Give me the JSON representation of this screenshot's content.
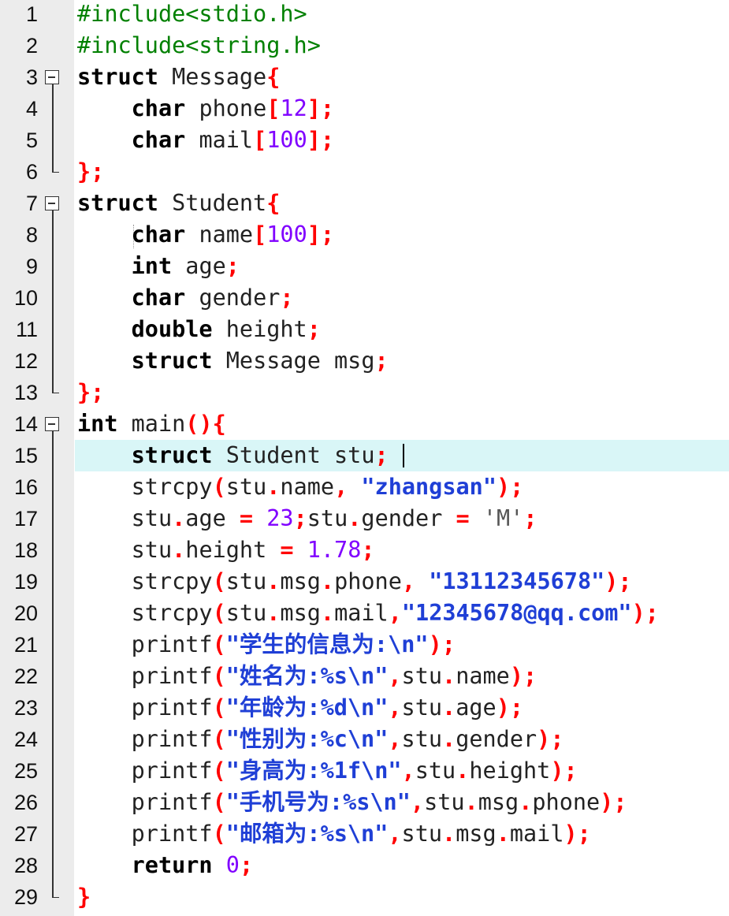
{
  "editor": {
    "language": "C",
    "current_line": 15,
    "lines": [
      {
        "n": "1",
        "tokens": [
          {
            "t": "#include<stdio.h>",
            "c": "pp"
          }
        ]
      },
      {
        "n": "2",
        "tokens": [
          {
            "t": "#include<string.h>",
            "c": "pp"
          }
        ]
      },
      {
        "n": "3",
        "tokens": [
          {
            "t": "struct",
            "c": "kw"
          },
          {
            "t": " Message",
            "c": "id"
          },
          {
            "t": "{",
            "c": "op"
          }
        ]
      },
      {
        "n": "4",
        "tokens": [
          {
            "t": "    ",
            "c": "id"
          },
          {
            "t": "char",
            "c": "kw"
          },
          {
            "t": " phone",
            "c": "id"
          },
          {
            "t": "[",
            "c": "op"
          },
          {
            "t": "12",
            "c": "num"
          },
          {
            "t": "];",
            "c": "op"
          }
        ]
      },
      {
        "n": "5",
        "tokens": [
          {
            "t": "    ",
            "c": "id"
          },
          {
            "t": "char",
            "c": "kw"
          },
          {
            "t": " mail",
            "c": "id"
          },
          {
            "t": "[",
            "c": "op"
          },
          {
            "t": "100",
            "c": "num"
          },
          {
            "t": "];",
            "c": "op"
          }
        ]
      },
      {
        "n": "6",
        "tokens": [
          {
            "t": "};",
            "c": "op"
          }
        ]
      },
      {
        "n": "7",
        "tokens": [
          {
            "t": "struct",
            "c": "kw"
          },
          {
            "t": " Student",
            "c": "id"
          },
          {
            "t": "{",
            "c": "op"
          }
        ]
      },
      {
        "n": "8",
        "tokens": [
          {
            "t": "    ",
            "c": "id"
          },
          {
            "t": "char",
            "c": "kw"
          },
          {
            "t": " name",
            "c": "id"
          },
          {
            "t": "[",
            "c": "op"
          },
          {
            "t": "100",
            "c": "num"
          },
          {
            "t": "];",
            "c": "op"
          }
        ]
      },
      {
        "n": "9",
        "tokens": [
          {
            "t": "    ",
            "c": "id"
          },
          {
            "t": "int",
            "c": "kw"
          },
          {
            "t": " age",
            "c": "id"
          },
          {
            "t": ";",
            "c": "op"
          }
        ]
      },
      {
        "n": "10",
        "tokens": [
          {
            "t": "    ",
            "c": "id"
          },
          {
            "t": "char",
            "c": "kw"
          },
          {
            "t": " gender",
            "c": "id"
          },
          {
            "t": ";",
            "c": "op"
          }
        ]
      },
      {
        "n": "11",
        "tokens": [
          {
            "t": "    ",
            "c": "id"
          },
          {
            "t": "double",
            "c": "kw"
          },
          {
            "t": " height",
            "c": "id"
          },
          {
            "t": ";",
            "c": "op"
          }
        ]
      },
      {
        "n": "12",
        "tokens": [
          {
            "t": "    ",
            "c": "id"
          },
          {
            "t": "struct",
            "c": "kw"
          },
          {
            "t": " Message msg",
            "c": "id"
          },
          {
            "t": ";",
            "c": "op"
          }
        ]
      },
      {
        "n": "13",
        "tokens": [
          {
            "t": "};",
            "c": "op"
          }
        ]
      },
      {
        "n": "14",
        "tokens": [
          {
            "t": "int",
            "c": "kw"
          },
          {
            "t": " main",
            "c": "id"
          },
          {
            "t": "(){",
            "c": "op"
          }
        ]
      },
      {
        "n": "15",
        "tokens": [
          {
            "t": "    ",
            "c": "id"
          },
          {
            "t": "struct",
            "c": "kw"
          },
          {
            "t": " Student stu",
            "c": "id"
          },
          {
            "t": ";",
            "c": "op"
          }
        ]
      },
      {
        "n": "16",
        "tokens": [
          {
            "t": "    strcpy",
            "c": "id"
          },
          {
            "t": "(",
            "c": "op"
          },
          {
            "t": "stu",
            "c": "id"
          },
          {
            "t": ".",
            "c": "op"
          },
          {
            "t": "name",
            "c": "id"
          },
          {
            "t": ", ",
            "c": "op"
          },
          {
            "t": "\"zhangsan\"",
            "c": "str"
          },
          {
            "t": ");",
            "c": "op"
          }
        ]
      },
      {
        "n": "17",
        "tokens": [
          {
            "t": "    stu",
            "c": "id"
          },
          {
            "t": ".",
            "c": "op"
          },
          {
            "t": "age ",
            "c": "id"
          },
          {
            "t": "=",
            "c": "op"
          },
          {
            "t": " ",
            "c": "id"
          },
          {
            "t": "23",
            "c": "num"
          },
          {
            "t": ";",
            "c": "op"
          },
          {
            "t": "stu",
            "c": "id"
          },
          {
            "t": ".",
            "c": "op"
          },
          {
            "t": "gender ",
            "c": "id"
          },
          {
            "t": "=",
            "c": "op"
          },
          {
            "t": " ",
            "c": "id"
          },
          {
            "t": "'M'",
            "c": "chr"
          },
          {
            "t": ";",
            "c": "op"
          }
        ]
      },
      {
        "n": "18",
        "tokens": [
          {
            "t": "    stu",
            "c": "id"
          },
          {
            "t": ".",
            "c": "op"
          },
          {
            "t": "height ",
            "c": "id"
          },
          {
            "t": "=",
            "c": "op"
          },
          {
            "t": " ",
            "c": "id"
          },
          {
            "t": "1.78",
            "c": "num"
          },
          {
            "t": ";",
            "c": "op"
          }
        ]
      },
      {
        "n": "19",
        "tokens": [
          {
            "t": "    strcpy",
            "c": "id"
          },
          {
            "t": "(",
            "c": "op"
          },
          {
            "t": "stu",
            "c": "id"
          },
          {
            "t": ".",
            "c": "op"
          },
          {
            "t": "msg",
            "c": "id"
          },
          {
            "t": ".",
            "c": "op"
          },
          {
            "t": "phone",
            "c": "id"
          },
          {
            "t": ", ",
            "c": "op"
          },
          {
            "t": "\"13112345678\"",
            "c": "str"
          },
          {
            "t": ");",
            "c": "op"
          }
        ]
      },
      {
        "n": "20",
        "tokens": [
          {
            "t": "    strcpy",
            "c": "id"
          },
          {
            "t": "(",
            "c": "op"
          },
          {
            "t": "stu",
            "c": "id"
          },
          {
            "t": ".",
            "c": "op"
          },
          {
            "t": "msg",
            "c": "id"
          },
          {
            "t": ".",
            "c": "op"
          },
          {
            "t": "mail",
            "c": "id"
          },
          {
            "t": ",",
            "c": "op"
          },
          {
            "t": "\"12345678@qq.com\"",
            "c": "str"
          },
          {
            "t": ");",
            "c": "op"
          }
        ]
      },
      {
        "n": "21",
        "tokens": [
          {
            "t": "    printf",
            "c": "id"
          },
          {
            "t": "(",
            "c": "op"
          },
          {
            "t": "\"学生的信息为:\\n\"",
            "c": "str"
          },
          {
            "t": ");",
            "c": "op"
          }
        ]
      },
      {
        "n": "22",
        "tokens": [
          {
            "t": "    printf",
            "c": "id"
          },
          {
            "t": "(",
            "c": "op"
          },
          {
            "t": "\"姓名为:%s\\n\"",
            "c": "str"
          },
          {
            "t": ",",
            "c": "op"
          },
          {
            "t": "stu",
            "c": "id"
          },
          {
            "t": ".",
            "c": "op"
          },
          {
            "t": "name",
            "c": "id"
          },
          {
            "t": ");",
            "c": "op"
          }
        ]
      },
      {
        "n": "23",
        "tokens": [
          {
            "t": "    printf",
            "c": "id"
          },
          {
            "t": "(",
            "c": "op"
          },
          {
            "t": "\"年龄为:%d\\n\"",
            "c": "str"
          },
          {
            "t": ",",
            "c": "op"
          },
          {
            "t": "stu",
            "c": "id"
          },
          {
            "t": ".",
            "c": "op"
          },
          {
            "t": "age",
            "c": "id"
          },
          {
            "t": ");",
            "c": "op"
          }
        ]
      },
      {
        "n": "24",
        "tokens": [
          {
            "t": "    printf",
            "c": "id"
          },
          {
            "t": "(",
            "c": "op"
          },
          {
            "t": "\"性别为:%c\\n\"",
            "c": "str"
          },
          {
            "t": ",",
            "c": "op"
          },
          {
            "t": "stu",
            "c": "id"
          },
          {
            "t": ".",
            "c": "op"
          },
          {
            "t": "gender",
            "c": "id"
          },
          {
            "t": ");",
            "c": "op"
          }
        ]
      },
      {
        "n": "25",
        "tokens": [
          {
            "t": "    printf",
            "c": "id"
          },
          {
            "t": "(",
            "c": "op"
          },
          {
            "t": "\"身高为:%1f\\n\"",
            "c": "str"
          },
          {
            "t": ",",
            "c": "op"
          },
          {
            "t": "stu",
            "c": "id"
          },
          {
            "t": ".",
            "c": "op"
          },
          {
            "t": "height",
            "c": "id"
          },
          {
            "t": ");",
            "c": "op"
          }
        ]
      },
      {
        "n": "26",
        "tokens": [
          {
            "t": "    printf",
            "c": "id"
          },
          {
            "t": "(",
            "c": "op"
          },
          {
            "t": "\"手机号为:%s\\n\"",
            "c": "str"
          },
          {
            "t": ",",
            "c": "op"
          },
          {
            "t": "stu",
            "c": "id"
          },
          {
            "t": ".",
            "c": "op"
          },
          {
            "t": "msg",
            "c": "id"
          },
          {
            "t": ".",
            "c": "op"
          },
          {
            "t": "phone",
            "c": "id"
          },
          {
            "t": ");",
            "c": "op"
          }
        ]
      },
      {
        "n": "27",
        "tokens": [
          {
            "t": "    printf",
            "c": "id"
          },
          {
            "t": "(",
            "c": "op"
          },
          {
            "t": "\"邮箱为:%s\\n\"",
            "c": "str"
          },
          {
            "t": ",",
            "c": "op"
          },
          {
            "t": "stu",
            "c": "id"
          },
          {
            "t": ".",
            "c": "op"
          },
          {
            "t": "msg",
            "c": "id"
          },
          {
            "t": ".",
            "c": "op"
          },
          {
            "t": "mail",
            "c": "id"
          },
          {
            "t": ");",
            "c": "op"
          }
        ]
      },
      {
        "n": "28",
        "tokens": [
          {
            "t": "    ",
            "c": "id"
          },
          {
            "t": "return",
            "c": "kw"
          },
          {
            "t": " ",
            "c": "id"
          },
          {
            "t": "0",
            "c": "num"
          },
          {
            "t": ";",
            "c": "op"
          }
        ]
      },
      {
        "n": "29",
        "tokens": [
          {
            "t": "}",
            "c": "op"
          }
        ]
      }
    ],
    "colors": {
      "keyword": "#000000",
      "preprocessor": "#008000",
      "operator": "#ff0000",
      "number": "#8000ff",
      "string": "#1f3fd6",
      "current_line_bg": "#d9f6f7",
      "gutter_bg": "#ececec"
    },
    "fold_markers": [
      {
        "start": 3,
        "end": 6
      },
      {
        "start": 7,
        "end": 13
      },
      {
        "start": 14,
        "end": 29
      }
    ]
  }
}
